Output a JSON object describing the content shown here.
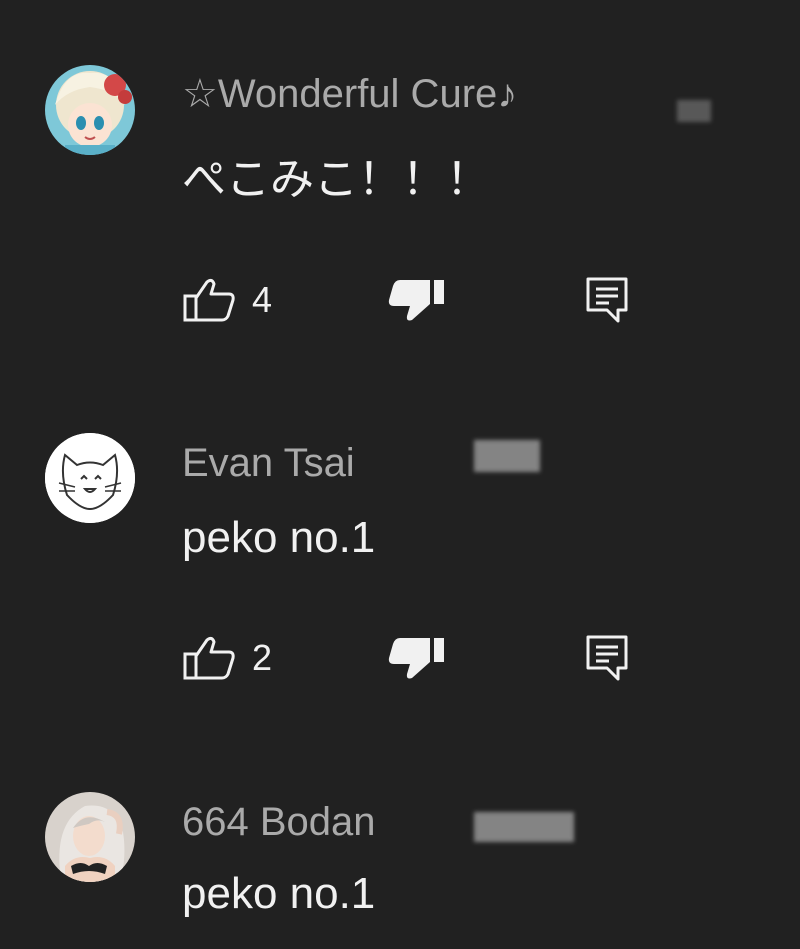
{
  "comments": [
    {
      "author": "☆Wonderful Cure♪",
      "text": "ぺこみこ！！！",
      "likes": "4",
      "avatar_icon": "anime-girl-avatar-icon"
    },
    {
      "author": "Evan Tsai",
      "text": "peko no.1",
      "likes": "2",
      "avatar_icon": "cat-sketch-avatar-icon"
    },
    {
      "author": "664 Bodan",
      "text": "peko no.1",
      "avatar_icon": "anime-girl-avatar-icon"
    }
  ],
  "icons": {
    "like": "thumbs-up-icon",
    "dislike": "thumbs-down-icon",
    "reply": "reply-icon"
  },
  "colors": {
    "background": "#212121",
    "author": "#aaaaaa",
    "text": "#f1f1f1"
  }
}
